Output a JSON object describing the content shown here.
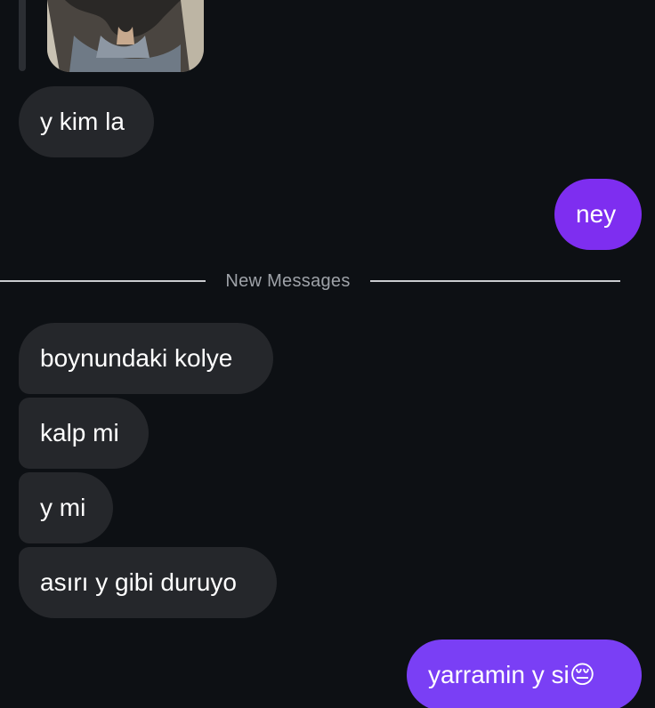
{
  "conversation": {
    "incoming_early": {
      "text": "y kim la"
    },
    "outgoing_early": {
      "text": "ney",
      "color": "#7e2ef0"
    },
    "divider": {
      "label": "New Messages"
    },
    "incoming_new": [
      {
        "text": "boynundaki kolye"
      },
      {
        "text": "kalp mi"
      },
      {
        "text": "y mi"
      },
      {
        "text": "asırı y gibi duruyo"
      }
    ],
    "outgoing_last": {
      "text": "yarramin y si",
      "emoji": "😔",
      "color": "#7a3ff5"
    }
  },
  "colors": {
    "background": "#0d1014",
    "incoming_bubble": "#25272b",
    "divider_line": "#c9cbcf",
    "divider_text": "#9ea2a8"
  }
}
